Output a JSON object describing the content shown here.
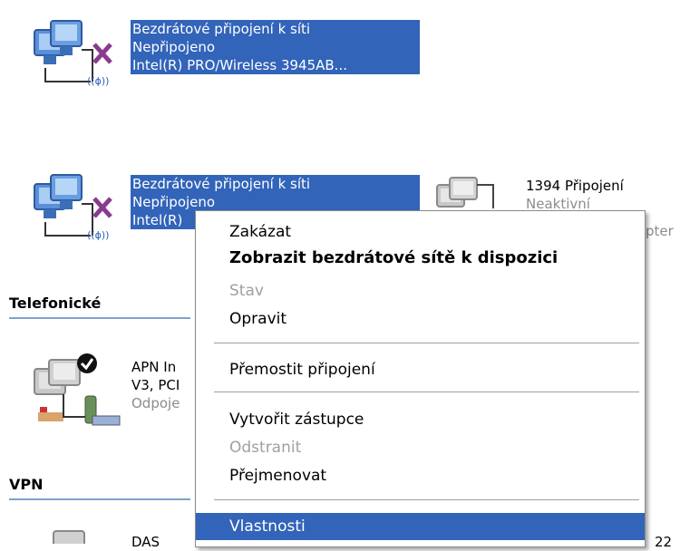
{
  "top_item": {
    "name": "Bezdrátové připojení k síti",
    "status": "Nepřipojeno",
    "device": "Intel(R) PRO/Wireless 3945AB..."
  },
  "second_item": {
    "name": "Bezdrátové připojení k síti",
    "status": "Nepřipojeno",
    "device": "Intel(R)"
  },
  "item_1394": {
    "name": "1394 Připojení",
    "status": "Neaktivní",
    "device": "pter"
  },
  "sections": {
    "telefonicke": "Telefonické",
    "vpn": "VPN"
  },
  "apn_item": {
    "line1": "APN In",
    "line2": "V3, PCI",
    "line3": "Odpoje"
  },
  "vpn_item": {
    "name": "DAS",
    "suffix": "22"
  },
  "context_menu": {
    "disable": "Zakázat",
    "show_networks": "Zobrazit bezdrátové sítě k dispozici",
    "status": "Stav",
    "repair": "Opravit",
    "bridge": "Přemostit připojení",
    "create_shortcut": "Vytvořit zástupce",
    "delete": "Odstranit",
    "rename": "Přejmenovat",
    "properties": "Vlastnosti"
  },
  "colors": {
    "selection": "#3264b9",
    "section_line": "#7da2ce",
    "disconnected_x": "#8a3a8e"
  }
}
